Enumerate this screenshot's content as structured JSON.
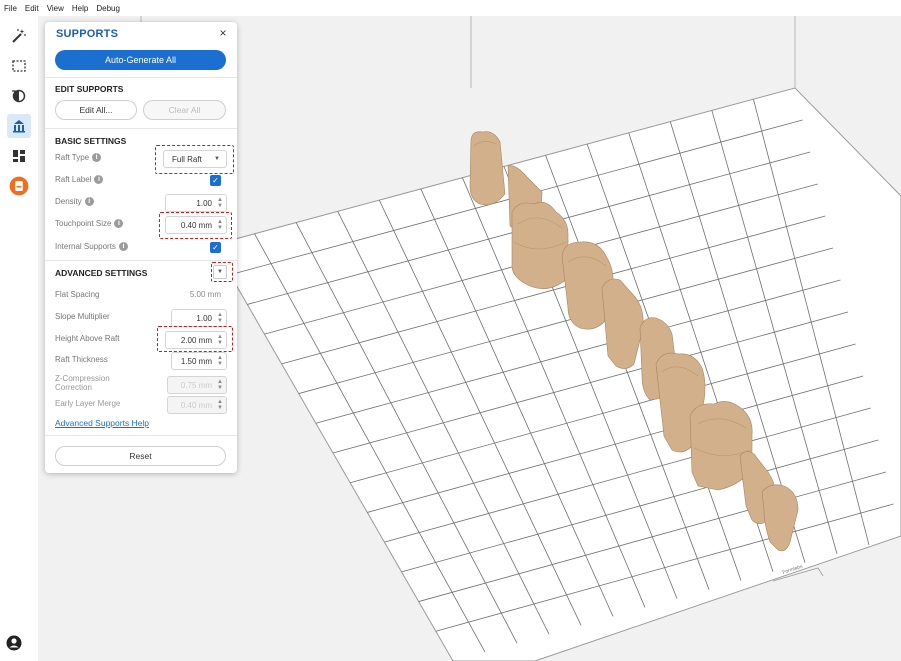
{
  "menu": [
    "File",
    "Edit",
    "View",
    "Help",
    "Debug"
  ],
  "toolbar": {
    "tools": [
      {
        "name": "magic-wand-icon",
        "active": false
      },
      {
        "name": "select-box-icon",
        "active": false
      },
      {
        "name": "orientation-icon",
        "active": false
      },
      {
        "name": "supports-icon",
        "active": true
      },
      {
        "name": "layout-icon",
        "active": false
      },
      {
        "name": "print-icon",
        "active": false
      }
    ],
    "account_icon": "account-icon"
  },
  "panel": {
    "title": "SUPPORTS",
    "close": "×",
    "auto_generate": "Auto-Generate All",
    "edit_supports_title": "EDIT SUPPORTS",
    "edit_all": "Edit All...",
    "clear_all": "Clear All",
    "basic_title": "BASIC SETTINGS",
    "basic": {
      "raft_type": {
        "label": "Raft Type",
        "value": "Full Raft"
      },
      "raft_label": {
        "label": "Raft Label",
        "checked": true
      },
      "density": {
        "label": "Density",
        "value": "1.00"
      },
      "touchpoint": {
        "label": "Touchpoint Size",
        "value": "0.40 mm"
      },
      "internal": {
        "label": "Internal Supports",
        "checked": true
      }
    },
    "advanced_title": "ADVANCED SETTINGS",
    "advanced": {
      "flat_spacing": {
        "label": "Flat Spacing",
        "value": "5.00 mm"
      },
      "slope": {
        "label": "Slope Multiplier",
        "value": "1.00"
      },
      "height_above": {
        "label": "Height Above Raft",
        "value": "2.00 mm"
      },
      "raft_thickness": {
        "label": "Raft Thickness",
        "value": "1.50 mm"
      },
      "z_comp": {
        "label": "Z-Compression Correction",
        "label_line1": "Z-Compression",
        "label_line2": "Correction",
        "value": "0.75 mm"
      },
      "early_layer": {
        "label": "Early Layer Merge",
        "value": "0.40 mm"
      }
    },
    "help_link": "Advanced Supports Help",
    "reset": "Reset"
  },
  "scene": {
    "build_plate_label": "Formlabs",
    "model_color": "#d2b08c"
  }
}
